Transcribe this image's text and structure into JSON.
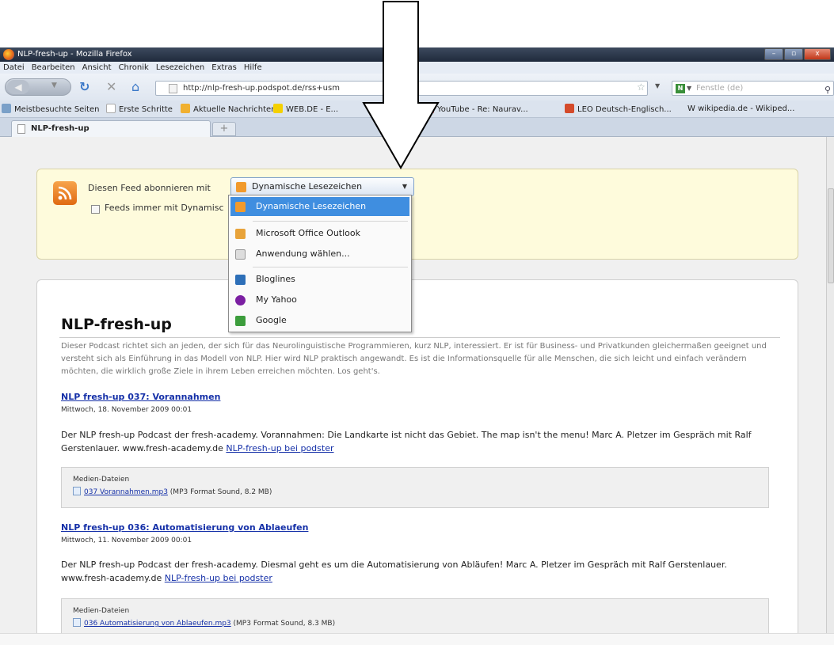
{
  "window": {
    "title": "NLP-fresh-up - Mozilla Firefox",
    "controls": {
      "minimize": "–",
      "maximize": "▫",
      "close": "x"
    }
  },
  "menu": [
    "Datei",
    "Bearbeiten",
    "Ansicht",
    "Chronik",
    "Lesezeichen",
    "Extras",
    "Hilfe"
  ],
  "nav": {
    "url": "http://nlp-fresh-up.podspot.de/rss+usm",
    "search_placeholder": "Fenstle (de)"
  },
  "bookmarks": [
    {
      "label": "Meistbesuchte Seiten",
      "color": "#7aa0c8"
    },
    {
      "label": "Erste Schritte",
      "color": "#ffffff"
    },
    {
      "label": "Aktuelle Nachrichten",
      "color": "#f0b030"
    },
    {
      "label": "WEB.DE - E...",
      "color": "#f4d000"
    },
    {
      "label": "YouTube - Re: Naurav...",
      "color": "#cc2222"
    },
    {
      "label": "LEO Deutsch-Englisch...",
      "color": "#d44a2a"
    },
    {
      "label": "W  wikipedia.de - Wikiped...",
      "color": "#eeeeee"
    }
  ],
  "tab": {
    "label": "NLP-fresh-up",
    "new_tab": "+"
  },
  "subscribe": {
    "label": "Diesen Feed abonnieren mit",
    "selected": "Dynamische Lesezeichen",
    "always_label": "Feeds immer mit Dynamisc"
  },
  "dropdown": {
    "items": [
      {
        "label": "Dynamische Lesezeichen",
        "color": "#f19a2c"
      },
      {
        "label": "Microsoft Office Outlook",
        "color": "#e8a33a"
      },
      {
        "label": "Anwendung wählen...",
        "color": "#dddddd"
      },
      {
        "label": "Bloglines",
        "color": "#2d6fb8"
      },
      {
        "label": "My Yahoo",
        "color": "#7b1fa2"
      },
      {
        "label": "Google",
        "color": "#3c9d3c"
      }
    ]
  },
  "feed": {
    "title": "NLP-fresh-up",
    "description": "Dieser Podcast richtet sich an jeden, der sich für das Neurolinguistische Programmieren, kurz NLP, interessiert. Er ist für Business- und Privatkunden gleichermaßen geeignet und versteht sich als Einführung in das Modell von NLP. Hier wird NLP praktisch angewandt. Es ist die Informationsquelle für alle Menschen, die sich leicht und einfach verändern möchten, die wirklich große Ziele in ihrem Leben erreichen möchten. Los geht's.",
    "entries": [
      {
        "title": "NLP fresh-up 037: Vorannahmen",
        "date": "Mittwoch, 18. November 2009 00:01",
        "text": "Der NLP fresh-up Podcast der fresh-academy. Vorannahmen: Die Landkarte ist nicht das Gebiet. The map isn't the menu! Marc A. Pletzer im Gespräch mit Ralf Gerstenlauer. www.fresh-academy.de",
        "link": "NLP-fresh-up bei podster",
        "media_label": "Medien-Dateien",
        "file": "037 Vorannahmen.mp3",
        "file_info": "(MP3 Format Sound, 8.2 MB)"
      },
      {
        "title": "NLP fresh-up 036: Automatisierung von Ablaeufen",
        "date": "Mittwoch, 11. November 2009 00:01",
        "text": "Der NLP fresh-up Podcast der fresh-academy. Diesmal geht es um die Automatisierung von Abläufen! Marc A. Pletzer im Gespräch mit Ralf Gerstenlauer. www.fresh-academy.de",
        "link": "NLP-fresh-up bei podster",
        "media_label": "Medien-Dateien",
        "file": "036 Automatisierung von Ablaeufen.mp3",
        "file_info": "(MP3 Format Sound, 8.3 MB)"
      }
    ]
  }
}
